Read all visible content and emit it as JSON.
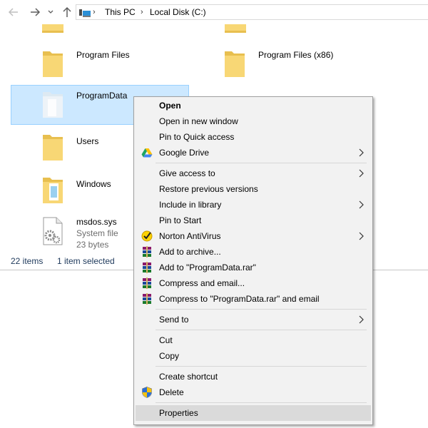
{
  "addressbar": {
    "crumbs": [
      "This PC",
      "Local Disk (C:)"
    ]
  },
  "files": {
    "program_files": "Program Files",
    "program_files_x86": "Program Files (x86)",
    "programdata": "ProgramData",
    "users": "Users",
    "windows": "Windows",
    "msdos": {
      "name": "msdos.sys",
      "type": "System file",
      "size": "23 bytes"
    }
  },
  "statusbar": {
    "count": "22 items",
    "selected": "1 item selected"
  },
  "context_menu": {
    "open": "Open",
    "open_new_window": "Open in new window",
    "pin_quick_access": "Pin to Quick access",
    "google_drive": "Google Drive",
    "give_access": "Give access to",
    "restore_versions": "Restore previous versions",
    "include_library": "Include in library",
    "pin_start": "Pin to Start",
    "norton": "Norton AntiVirus",
    "add_archive": "Add to archive...",
    "add_rar": "Add to \"ProgramData.rar\"",
    "compress_email": "Compress and email...",
    "compress_rar_email": "Compress to \"ProgramData.rar\" and email",
    "send_to": "Send to",
    "cut": "Cut",
    "copy": "Copy",
    "create_shortcut": "Create shortcut",
    "delete": "Delete",
    "properties": "Properties"
  },
  "colors": {
    "selection_bg": "#cce8ff",
    "selection_border": "#99d1ff",
    "menu_bg": "#f2f2f2",
    "menu_hover": "#dadada",
    "folder_yellow": "#f8d775",
    "status_text": "#1e395b"
  },
  "icons": {
    "back": "arrow-left-icon",
    "forward": "arrow-right-icon",
    "recent": "chevron-down-icon",
    "up": "arrow-up-icon",
    "address": "this-pc-icon",
    "folder": "folder-icon",
    "file": "system-file-gear-icon",
    "google_drive": "google-drive-icon",
    "norton": "norton-check-icon",
    "winrar": "winrar-books-icon",
    "shield": "uac-shield-icon",
    "submenu": "chevron-right-icon"
  }
}
